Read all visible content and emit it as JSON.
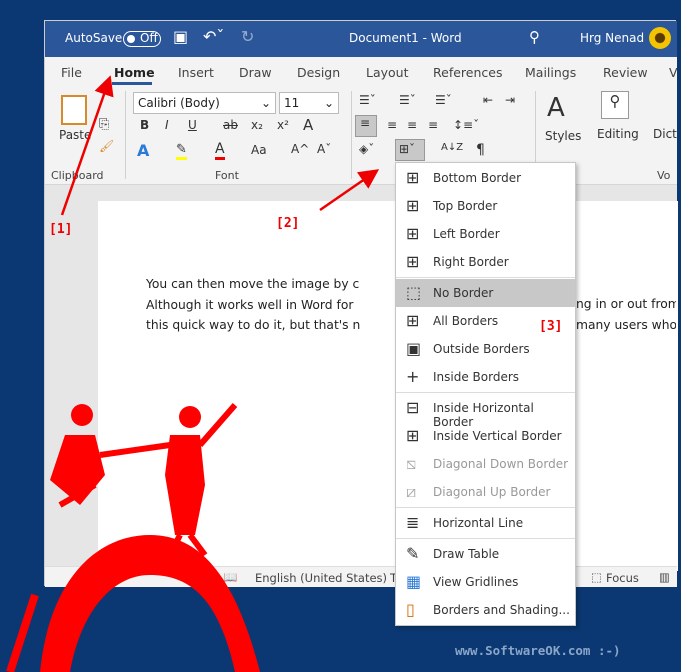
{
  "titlebar": {
    "autosave_label": "AutoSave",
    "autosave_state": "Off",
    "document_title": "Document1  -  Word",
    "user_name": "Hrg Nenad"
  },
  "tabs": [
    "File",
    "Home",
    "Insert",
    "Draw",
    "Design",
    "Layout",
    "References",
    "Mailings",
    "Review",
    "V"
  ],
  "active_tab": "Home",
  "ribbon": {
    "paste_label": "Paste",
    "clipboard_group": "Clipboard",
    "font_name": "Calibri (Body)",
    "font_size": "11",
    "font_group": "Font",
    "styles_label": "Styles",
    "editing_label": "Editing",
    "dictate_label": "Dict",
    "voice_group": "Vo",
    "bold": "B",
    "italic": "I",
    "underline": "U",
    "strike": "ab",
    "subscript": "x₂",
    "superscript": "x²",
    "text_effects": "A",
    "change_case": "Aa",
    "grow": "A^",
    "shrink": "Aˇ",
    "pilcrow": "¶",
    "sort": "A↓Z"
  },
  "document": {
    "lines": [
      "You can then move the image by c",
      "Although it works well in Word for",
      "this quick way to do it, but that's n"
    ],
    "right_lines": [
      "ng in or out from",
      "many users who",
      ""
    ]
  },
  "status": {
    "language": "English (United States)",
    "t": "T",
    "focus": "Focus"
  },
  "borders_menu": {
    "items": [
      {
        "label": "Bottom Border",
        "icon": "bottom-border-icon",
        "disabled": false
      },
      {
        "label": "Top Border",
        "icon": "top-border-icon",
        "disabled": false
      },
      {
        "label": "Left Border",
        "icon": "left-border-icon",
        "disabled": false
      },
      {
        "label": "Right Border",
        "icon": "right-border-icon",
        "disabled": false
      },
      {
        "label": "No Border",
        "icon": "no-border-icon",
        "disabled": false,
        "highlighted": true
      },
      {
        "label": "All Borders",
        "icon": "all-borders-icon",
        "disabled": false
      },
      {
        "label": "Outside Borders",
        "icon": "outside-borders-icon",
        "disabled": false
      },
      {
        "label": "Inside Borders",
        "icon": "inside-borders-icon",
        "disabled": false
      },
      {
        "label": "Inside Horizontal Border",
        "icon": "inside-horizontal-border-icon",
        "disabled": false
      },
      {
        "label": "Inside Vertical Border",
        "icon": "inside-vertical-border-icon",
        "disabled": false
      },
      {
        "label": "Diagonal Down Border",
        "icon": "diagonal-down-border-icon",
        "disabled": true
      },
      {
        "label": "Diagonal Up Border",
        "icon": "diagonal-up-border-icon",
        "disabled": true
      },
      {
        "label": "Horizontal Line",
        "icon": "horizontal-line-icon",
        "disabled": false
      },
      {
        "label": "Draw Table",
        "icon": "draw-table-icon",
        "disabled": false
      },
      {
        "label": "View Gridlines",
        "icon": "view-gridlines-icon",
        "disabled": false
      },
      {
        "label": "Borders and Shading...",
        "icon": "borders-shading-icon",
        "disabled": false
      }
    ]
  },
  "annotations": {
    "a1": "[1]",
    "a2": "[2]",
    "a3": "[3]",
    "watermark": "www.SoftwareOK.com :-)"
  },
  "colors": {
    "title_bar": "#2b579a",
    "background": "#0b3872",
    "annotation": "#ff0000",
    "highlight_yellow": "#ffff00",
    "font_color_red": "#e00000"
  }
}
